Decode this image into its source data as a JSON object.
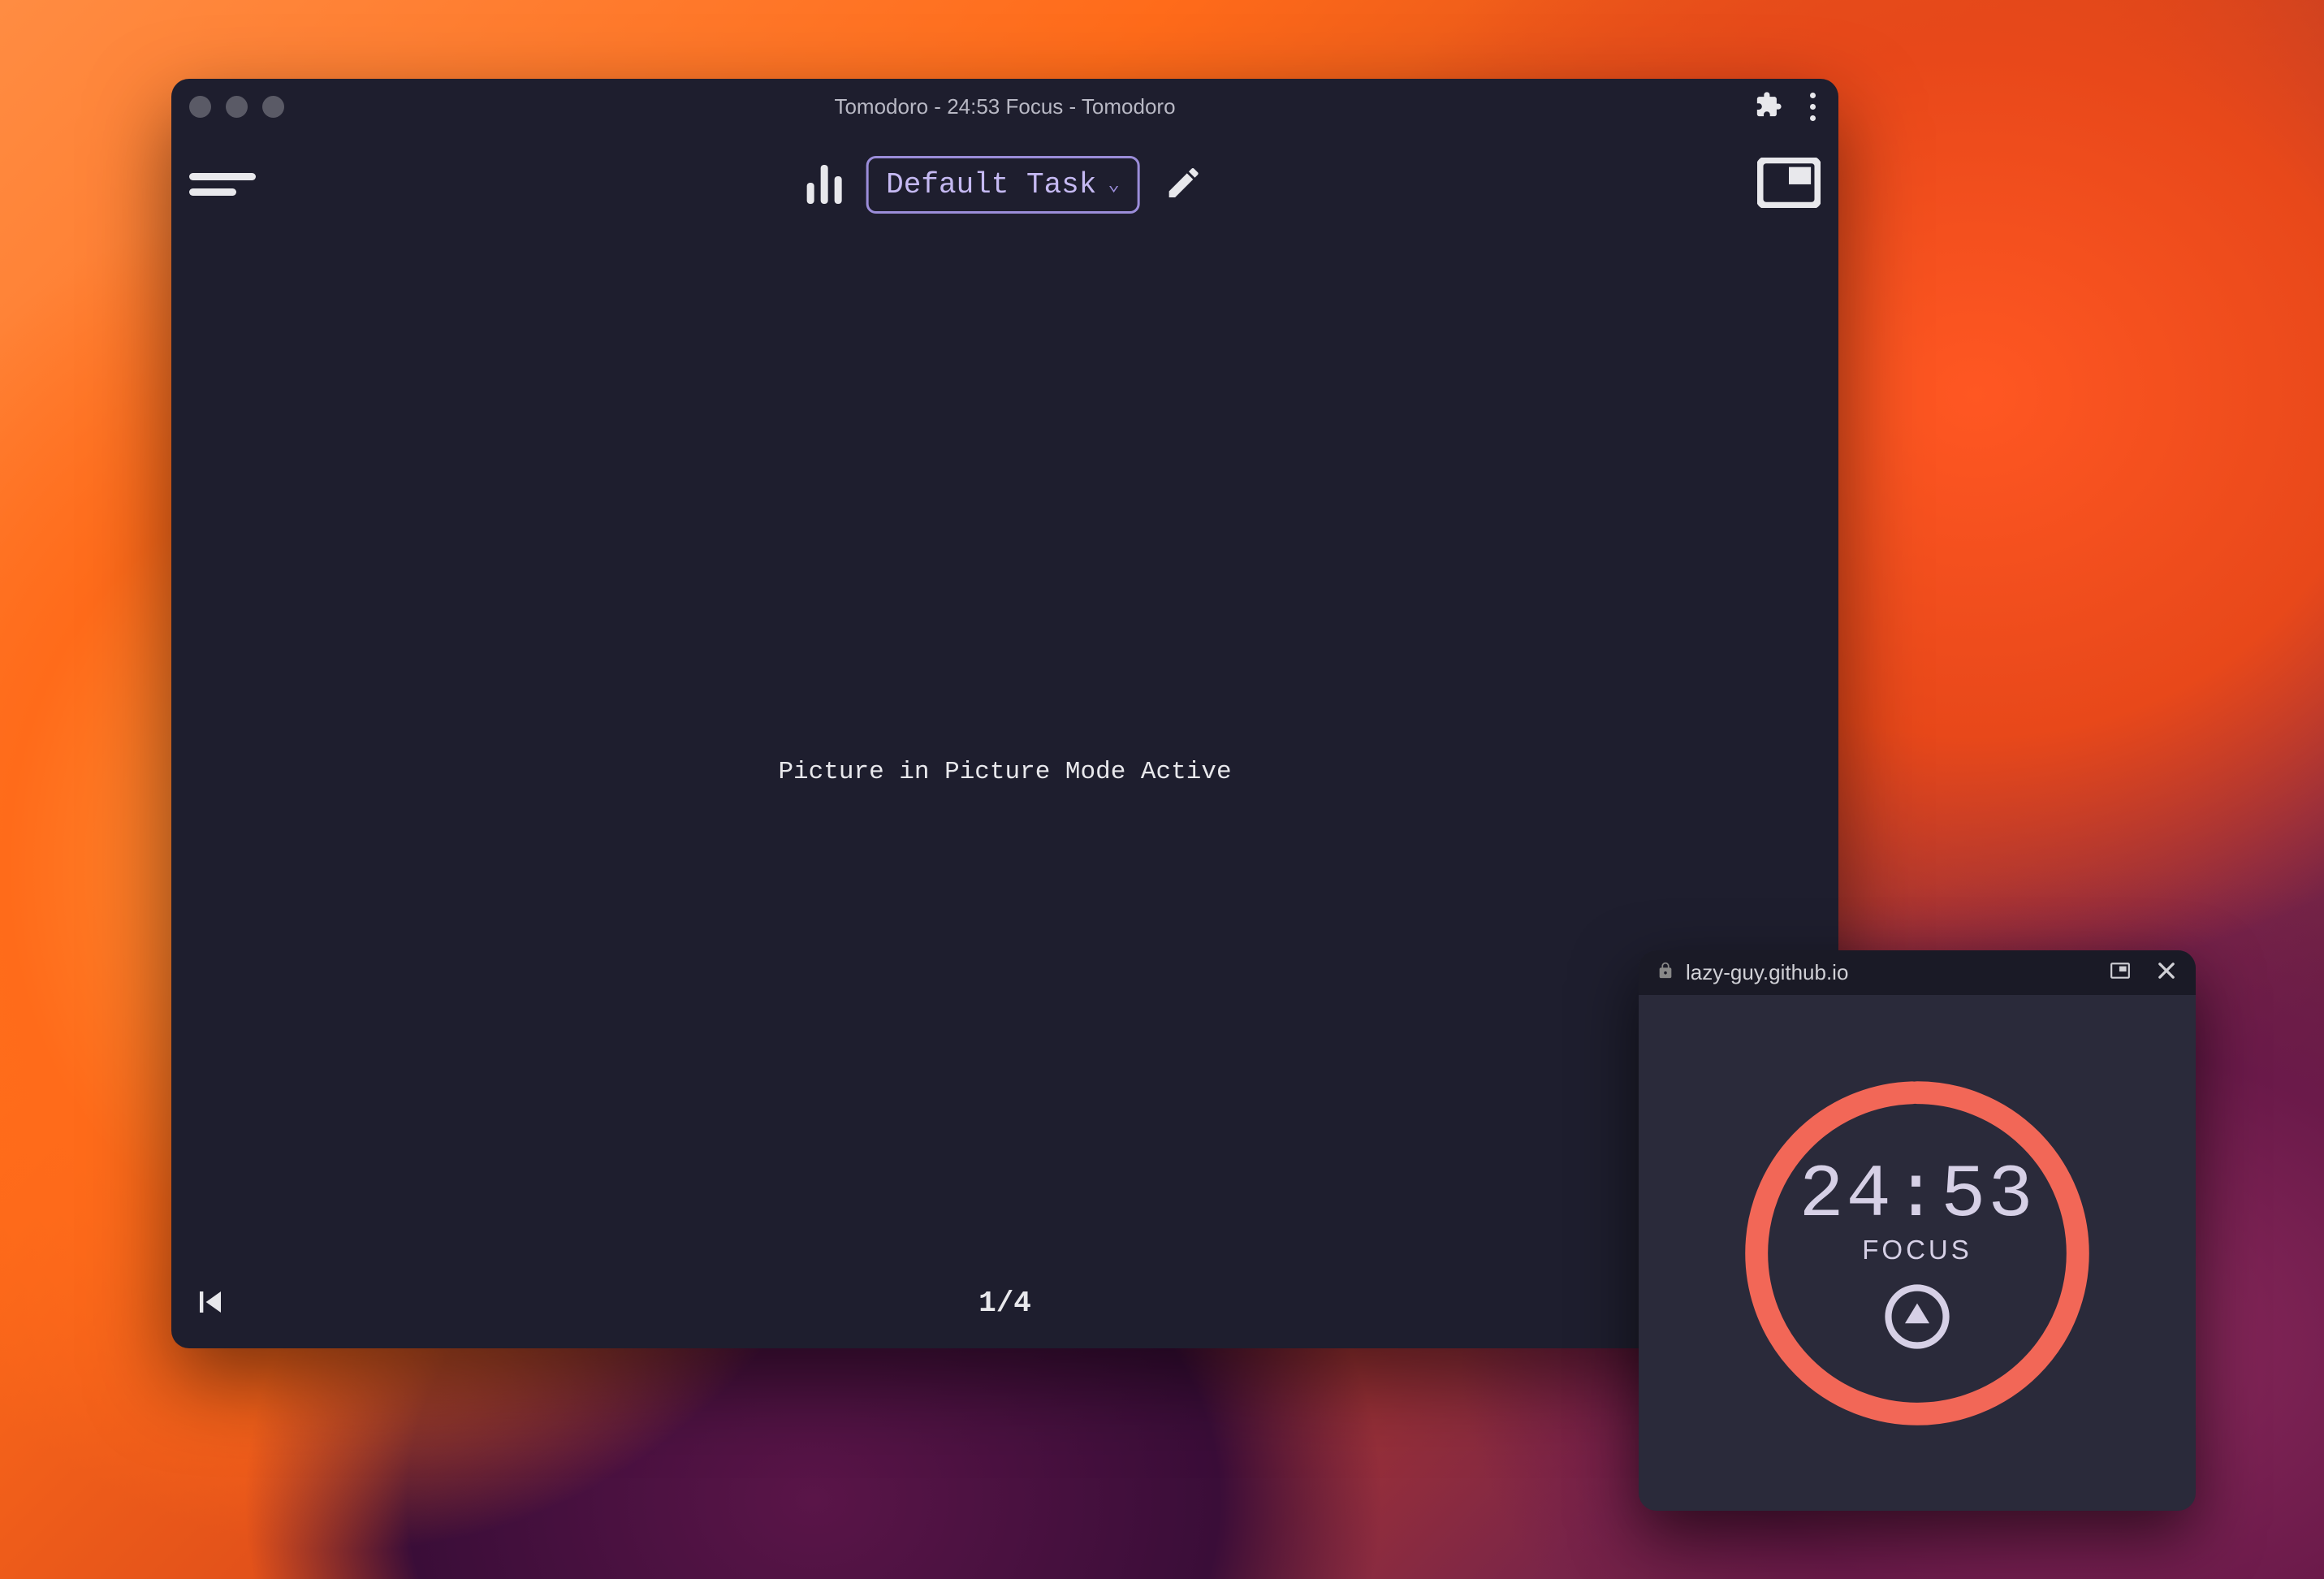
{
  "window": {
    "title": "Tomodoro - 24:53 Focus - Tomodoro"
  },
  "toolbar": {
    "task_label": "Default Task"
  },
  "main": {
    "pip_status": "Picture in Picture Mode Active",
    "page_indicator": "1/4"
  },
  "pip": {
    "url": "lazy-guy.github.io",
    "time": "24:53",
    "label": "FOCUS",
    "ring_color": "#f26757",
    "progress": 0.994
  }
}
